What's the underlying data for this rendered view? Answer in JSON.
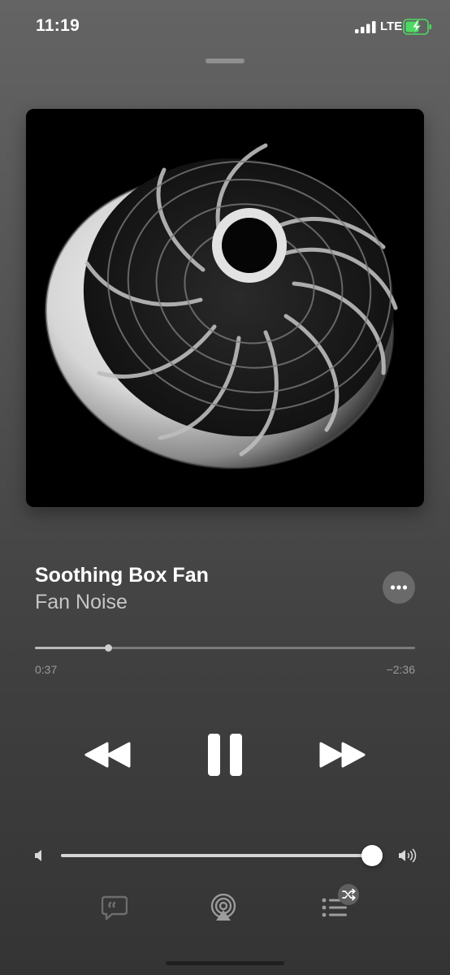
{
  "status_bar": {
    "time": "11:19",
    "network": "LTE",
    "battery_icon": "battery-charging-icon",
    "battery_color": "#4cd964"
  },
  "now_playing": {
    "title": "Soothing Box Fan",
    "artist": "Fan Noise",
    "more_icon": "ellipsis-icon"
  },
  "playback": {
    "elapsed": "0:37",
    "remaining": "−2:36",
    "progress_fraction": 0.194,
    "state": "playing"
  },
  "volume": {
    "level_fraction": 1.0
  },
  "bottom_bar": {
    "icons": [
      "lyrics-icon",
      "airplay-icon",
      "queue-icon",
      "shuffle-icon"
    ]
  },
  "colors": {
    "background": "#4c4c4c",
    "title": "#ffffff",
    "artist": "#c6c6c6"
  }
}
